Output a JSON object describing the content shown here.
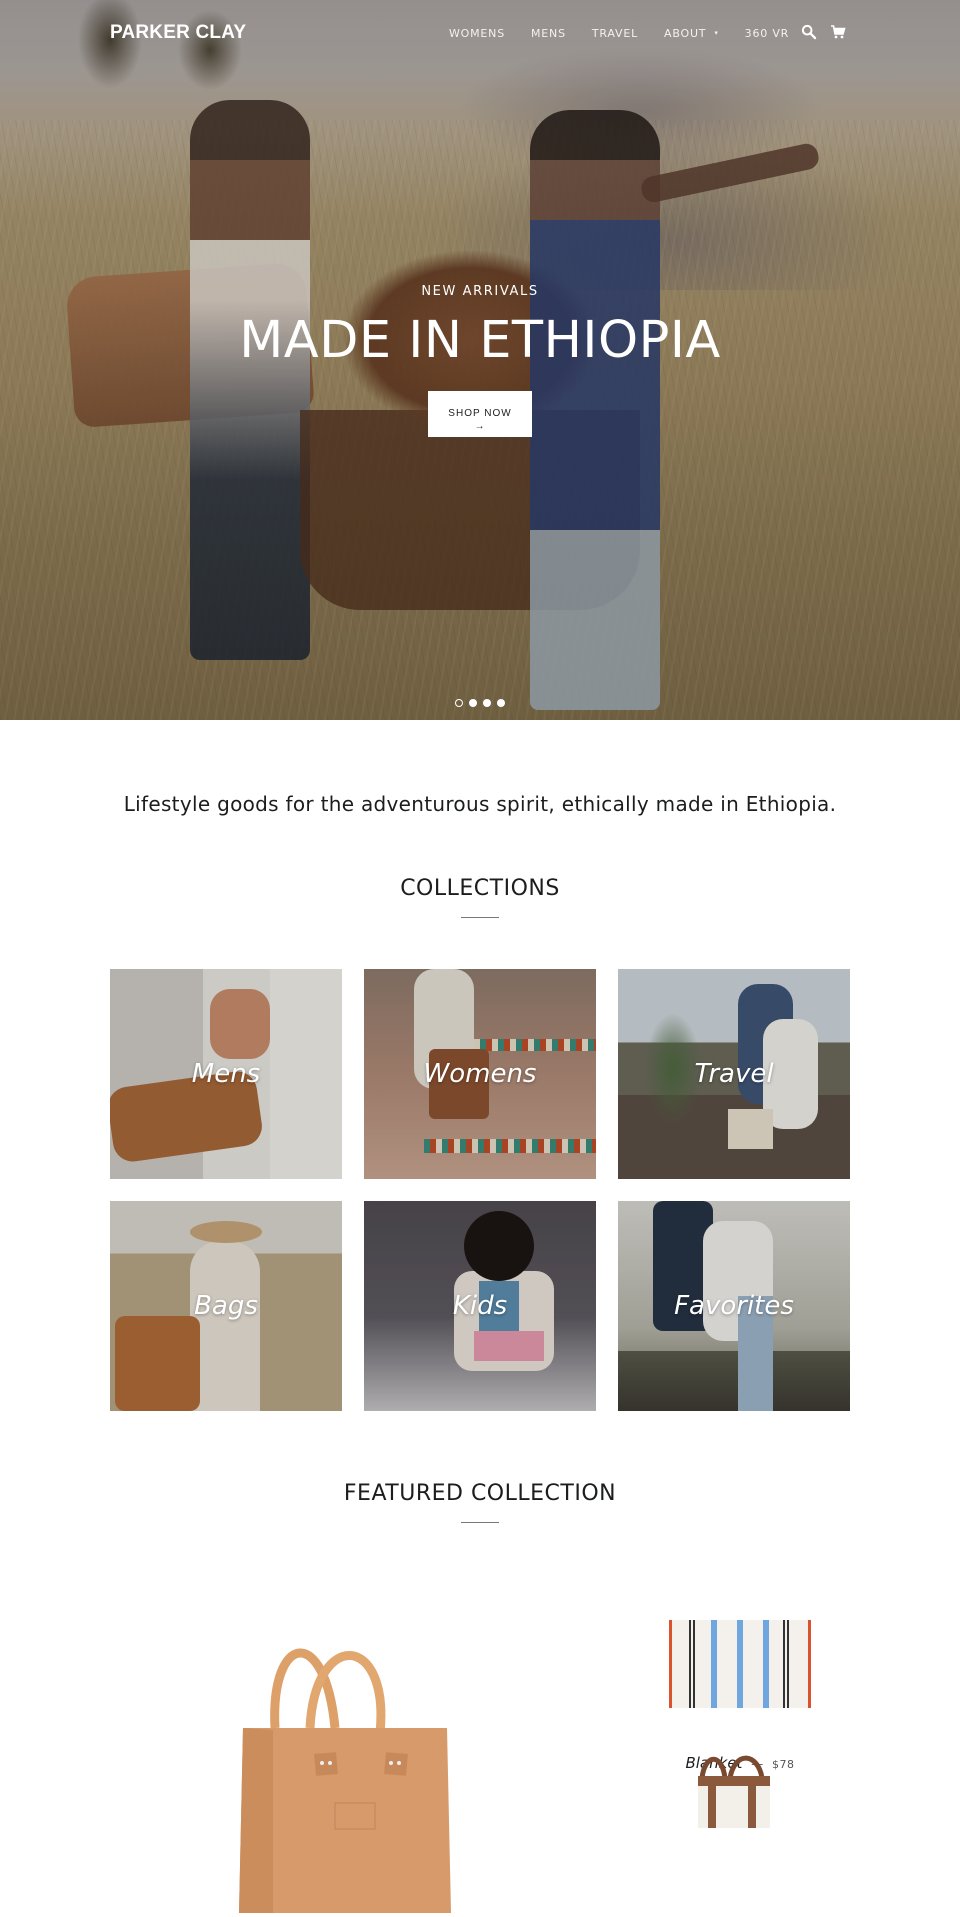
{
  "header": {
    "logo": "PARKER CLAY",
    "nav": [
      {
        "label": "WOMENS"
      },
      {
        "label": "MENS"
      },
      {
        "label": "TRAVEL"
      },
      {
        "label": "ABOUT",
        "has_dropdown": true,
        "caret": "▾"
      },
      {
        "label": "360 VR"
      }
    ],
    "icons": {
      "search": "search-icon",
      "cart": "cart-icon"
    }
  },
  "hero": {
    "eyebrow": "NEW ARRIVALS",
    "title": "MADE IN ETHIOPIA",
    "button_label": "SHOP NOW",
    "button_arrow": "→",
    "slides_total": 4,
    "active_slide": 1
  },
  "intro": {
    "tagline": "Lifestyle goods for the adventurous spirit, ethically made in Ethiopia."
  },
  "collections": {
    "title": "COLLECTIONS",
    "items": [
      {
        "label": "Mens"
      },
      {
        "label": "Womens"
      },
      {
        "label": "Travel"
      },
      {
        "label": "Bags"
      },
      {
        "label": "Kids"
      },
      {
        "label": "Favorites"
      }
    ]
  },
  "featured": {
    "title": "FEATURED COLLECTION",
    "products": [
      {
        "name": "Blanket",
        "separator": "—",
        "price": "$78"
      }
    ]
  },
  "colors": {
    "text": "#1c1d1d",
    "white": "#ffffff",
    "rule": "#777777"
  }
}
